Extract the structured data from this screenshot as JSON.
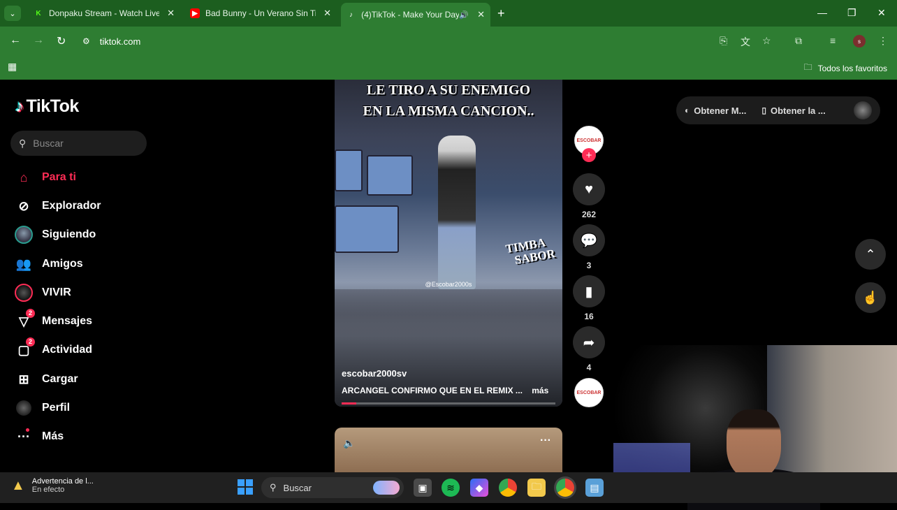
{
  "browser": {
    "tabs": [
      {
        "title": "Donpaku Stream - Watch Live c",
        "favicon": "K",
        "favicon_color": "#53fc18"
      },
      {
        "title": "Bad Bunny - Un Verano Sin Ti A",
        "favicon": "▶",
        "favicon_color": "#ff0000"
      },
      {
        "title": "(4)TikTok - Make Your Day",
        "favicon": "♪",
        "favicon_color": "#000000"
      }
    ],
    "url": "tiktok.com",
    "bookmarks_all": "Todos los favoritos",
    "profile_initial": "s"
  },
  "tiktok": {
    "logo_text": "TikTok",
    "search_placeholder": "Buscar",
    "nav": [
      {
        "label": "Para ti",
        "icon": "home-icon",
        "badge": ""
      },
      {
        "label": "Explorador",
        "icon": "compass-icon",
        "badge": ""
      },
      {
        "label": "Siguiendo",
        "icon": "following-avatar-icon",
        "badge": ""
      },
      {
        "label": "Amigos",
        "icon": "friends-icon",
        "badge": ""
      },
      {
        "label": "VIVIR",
        "icon": "live-icon",
        "badge": ""
      },
      {
        "label": "Mensajes",
        "icon": "messages-icon",
        "badge": "2"
      },
      {
        "label": "Actividad",
        "icon": "activity-icon",
        "badge": "2"
      },
      {
        "label": "Cargar",
        "icon": "upload-icon",
        "badge": ""
      },
      {
        "label": "Perfil",
        "icon": "profile-icon",
        "badge": ""
      },
      {
        "label": "Más",
        "icon": "more-icon",
        "badge": ""
      }
    ],
    "video": {
      "caption_line1": "LE TIRO A SU ENEMIGO",
      "caption_line2": "EN LA MISMA CANCION..",
      "watermark": "@Escobar2000s",
      "overlay_logo_1": "TIMBA",
      "overlay_logo_2": "SABOR",
      "author": "escobar2000sv",
      "description": "ARCANGEL CONFIRMO QUE EN EL REMIX ...",
      "more": "más",
      "progress": 0.07
    },
    "actions": {
      "likes": "262",
      "comments": "3",
      "saves": "16",
      "shares": "4",
      "follow_symbol": "+"
    },
    "top_right": {
      "get_coins": "Obtener M...",
      "get_app": "Obtener la ..."
    }
  },
  "taskbar": {
    "notice_title": "Advertencia de l...",
    "notice_status": "En efecto",
    "search_placeholder": "Buscar"
  }
}
